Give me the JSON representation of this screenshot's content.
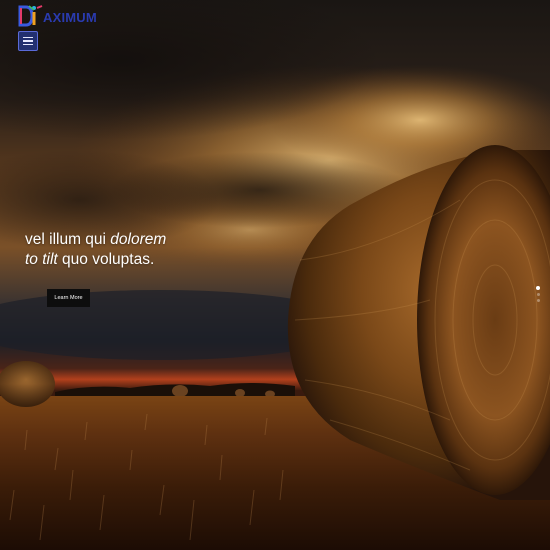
{
  "brand": {
    "logo_letters": "Di",
    "name": "AXIMUM"
  },
  "nav": {
    "menu_icon": "hamburger-icon"
  },
  "hero": {
    "line1_plain": "vel illum qui ",
    "line1_italic": "dolorem",
    "line2_italic": "to tilt",
    "line2_plain": " quo voluptas.",
    "cta_label": "Learn More",
    "background": "sunset field with hay bales",
    "slide_count": 3,
    "active_slide": 1
  },
  "colors": {
    "brand_text": "#2a3bb0",
    "menu_button": "#223070",
    "cta_background": "#0d0d0d"
  }
}
